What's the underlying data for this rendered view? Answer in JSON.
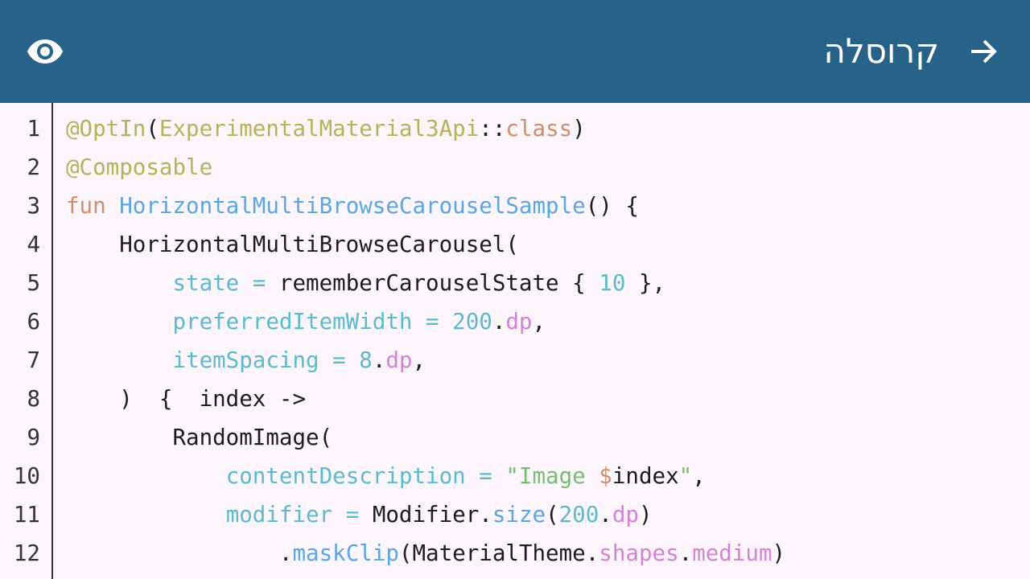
{
  "app_bar": {
    "title": "קרוסלה",
    "back_icon": "arrow-forward-icon",
    "view_icon": "eye-icon",
    "background": "#276288"
  },
  "code": {
    "lines": [
      {
        "num": "1",
        "tokens": [
          {
            "t": "@OptIn",
            "c": "ann"
          },
          {
            "t": "(",
            "c": "punc"
          },
          {
            "t": "ExperimentalMaterial3Api",
            "c": "ann"
          },
          {
            "t": "::",
            "c": "punc"
          },
          {
            "t": "class",
            "c": "kw"
          },
          {
            "t": ")",
            "c": "punc"
          }
        ]
      },
      {
        "num": "2",
        "tokens": [
          {
            "t": "@Composable",
            "c": "ann"
          }
        ]
      },
      {
        "num": "3",
        "tokens": [
          {
            "t": "fun ",
            "c": "kw"
          },
          {
            "t": "HorizontalMultiBrowseCarouselSample",
            "c": "fn"
          },
          {
            "t": "() {",
            "c": "punc"
          }
        ]
      },
      {
        "num": "4",
        "tokens": [
          {
            "t": "    HorizontalMultiBrowseCarousel(",
            "c": "punc"
          }
        ]
      },
      {
        "num": "5",
        "tokens": [
          {
            "t": "        ",
            "c": "punc"
          },
          {
            "t": "state",
            "c": "param"
          },
          {
            "t": " = ",
            "c": "param"
          },
          {
            "t": "rememberCarouselState { ",
            "c": "punc"
          },
          {
            "t": "10",
            "c": "num"
          },
          {
            "t": " },",
            "c": "punc"
          }
        ]
      },
      {
        "num": "6",
        "tokens": [
          {
            "t": "        ",
            "c": "punc"
          },
          {
            "t": "preferredItemWidth",
            "c": "param"
          },
          {
            "t": " = ",
            "c": "param"
          },
          {
            "t": "200",
            "c": "num"
          },
          {
            "t": ".",
            "c": "punc"
          },
          {
            "t": "dp",
            "c": "prop"
          },
          {
            "t": ",",
            "c": "punc"
          }
        ]
      },
      {
        "num": "7",
        "tokens": [
          {
            "t": "        ",
            "c": "punc"
          },
          {
            "t": "itemSpacing",
            "c": "param"
          },
          {
            "t": " = ",
            "c": "param"
          },
          {
            "t": "8",
            "c": "num"
          },
          {
            "t": ".",
            "c": "punc"
          },
          {
            "t": "dp",
            "c": "prop"
          },
          {
            "t": ",",
            "c": "punc"
          }
        ]
      },
      {
        "num": "8",
        "tokens": [
          {
            "t": "    )  {  index ->",
            "c": "punc"
          }
        ]
      },
      {
        "num": "9",
        "tokens": [
          {
            "t": "        RandomImage(",
            "c": "punc"
          }
        ]
      },
      {
        "num": "10",
        "tokens": [
          {
            "t": "            ",
            "c": "punc"
          },
          {
            "t": "contentDescription",
            "c": "param"
          },
          {
            "t": " = ",
            "c": "param"
          },
          {
            "t": "\"Image ",
            "c": "str"
          },
          {
            "t": "$",
            "c": "kw"
          },
          {
            "t": "index",
            "c": "punc"
          },
          {
            "t": "\"",
            "c": "str"
          },
          {
            "t": ",",
            "c": "punc"
          }
        ]
      },
      {
        "num": "11",
        "tokens": [
          {
            "t": "            ",
            "c": "punc"
          },
          {
            "t": "modifier",
            "c": "param"
          },
          {
            "t": " = ",
            "c": "param"
          },
          {
            "t": "Modifier",
            "c": "punc"
          },
          {
            "t": ".",
            "c": "punc"
          },
          {
            "t": "size",
            "c": "fn"
          },
          {
            "t": "(",
            "c": "punc"
          },
          {
            "t": "200",
            "c": "num"
          },
          {
            "t": ".",
            "c": "punc"
          },
          {
            "t": "dp",
            "c": "prop"
          },
          {
            "t": ")",
            "c": "punc"
          }
        ]
      },
      {
        "num": "12",
        "tokens": [
          {
            "t": "                .",
            "c": "punc"
          },
          {
            "t": "maskClip",
            "c": "fn"
          },
          {
            "t": "(MaterialTheme.",
            "c": "punc"
          },
          {
            "t": "shapes",
            "c": "prop"
          },
          {
            "t": ".",
            "c": "punc"
          },
          {
            "t": "medium",
            "c": "prop"
          },
          {
            "t": ")",
            "c": "punc"
          }
        ]
      }
    ]
  }
}
